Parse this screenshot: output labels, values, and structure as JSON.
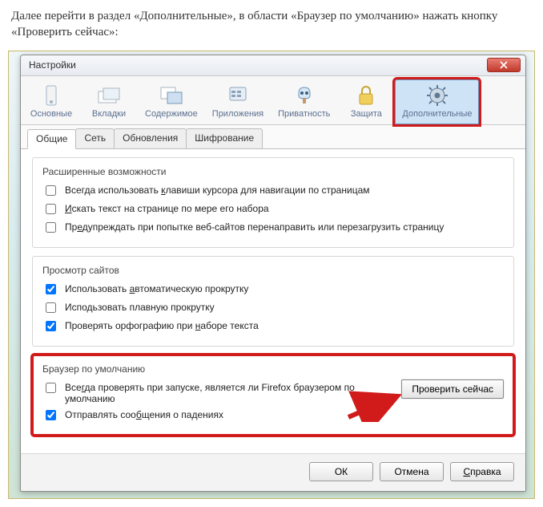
{
  "instruction": "Далее перейти в раздел «Дополнительные», в области «Браузер по умолчанию» нажать кнопку «Проверить сейчас»:",
  "window": {
    "title": "Настройки"
  },
  "toolbar": {
    "items": [
      {
        "label": "Основные"
      },
      {
        "label": "Вкладки"
      },
      {
        "label": "Содержимое"
      },
      {
        "label": "Приложения"
      },
      {
        "label": "Приватность"
      },
      {
        "label": "Защита"
      },
      {
        "label": "Дополнительные"
      }
    ]
  },
  "tabs": [
    {
      "label": "Общие"
    },
    {
      "label": "Сеть"
    },
    {
      "label": "Обновления"
    },
    {
      "label": "Шифрование"
    }
  ],
  "groups": {
    "ext": {
      "legend": "Расширенные возможности",
      "opts": [
        {
          "label": "Всегда использовать клавиши курсора для навигации по страницам",
          "checked": false
        },
        {
          "label": "Искать текст на странице по мере его набора",
          "checked": false
        },
        {
          "label": "Предупреждать при попытке веб-сайтов перенаправить или перезагрузить страницу",
          "checked": false
        }
      ]
    },
    "view": {
      "legend": "Просмотр сайтов",
      "opts": [
        {
          "label": "Использовать автоматическую прокрутку",
          "checked": true
        },
        {
          "label": "Исподьзовать плавную прокрутку",
          "checked": false
        },
        {
          "label": "Проверять орфографию при наборе текста",
          "checked": true
        }
      ]
    },
    "default": {
      "legend": "Браузер по умолчанию",
      "opts": [
        {
          "label": "Всегда проверять при запуске, является ли Firefox браузером по умолчанию",
          "checked": false
        },
        {
          "label": "Отправлять сообщения о падениях",
          "checked": true
        }
      ],
      "button": "Проверить сейчас"
    }
  },
  "footer": {
    "ok": "ОК",
    "cancel": "Отмена",
    "help": "Справка"
  }
}
